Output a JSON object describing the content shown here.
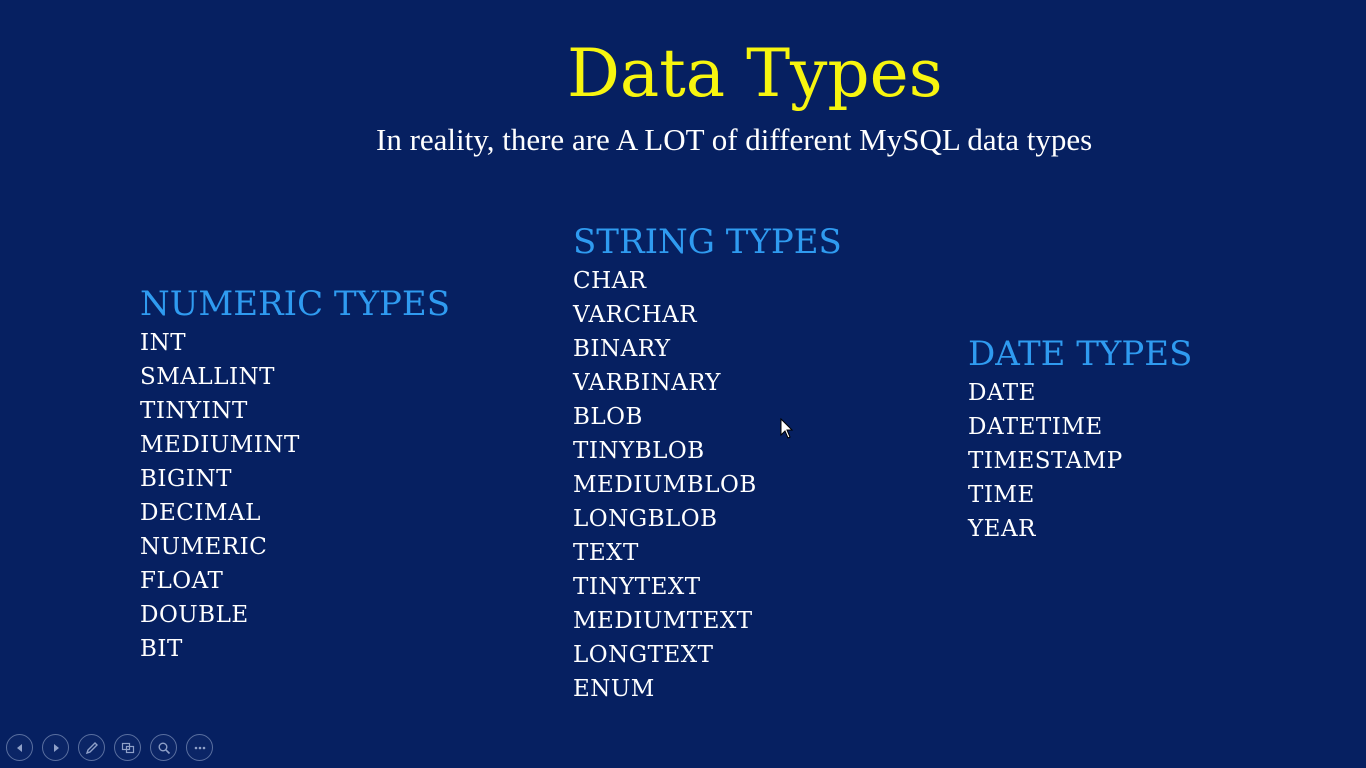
{
  "slide": {
    "title": "Data Types",
    "subtitle": "In reality, there are A LOT of different MySQL data types"
  },
  "columns": {
    "numeric": {
      "heading": "NUMERIC TYPES",
      "items": [
        "INT",
        "SMALLINT",
        "TINYINT",
        "MEDIUMINT",
        "BIGINT",
        "DECIMAL",
        "NUMERIC",
        "FLOAT",
        "DOUBLE",
        "BIT"
      ]
    },
    "string": {
      "heading": "STRING TYPES",
      "items": [
        "CHAR",
        "VARCHAR",
        "BINARY",
        "VARBINARY",
        "BLOB",
        "TINYBLOB",
        "MEDIUMBLOB",
        "LONGBLOB",
        "TEXT",
        "TINYTEXT",
        "MEDIUMTEXT",
        "LONGTEXT",
        "ENUM"
      ]
    },
    "date": {
      "heading": "DATE TYPES",
      "items": [
        "DATE",
        "DATETIME",
        "TIMESTAMP",
        "TIME",
        "YEAR"
      ]
    }
  },
  "controls": [
    {
      "icon": "previous-slide-icon"
    },
    {
      "icon": "next-slide-icon"
    },
    {
      "icon": "pen-icon"
    },
    {
      "icon": "see-all-slides-icon"
    },
    {
      "icon": "zoom-icon"
    },
    {
      "icon": "more-options-icon"
    }
  ],
  "colors": {
    "background": "#062061",
    "title": "#f7f50f",
    "heading": "#2f9bf0",
    "text": "#ffffff"
  }
}
